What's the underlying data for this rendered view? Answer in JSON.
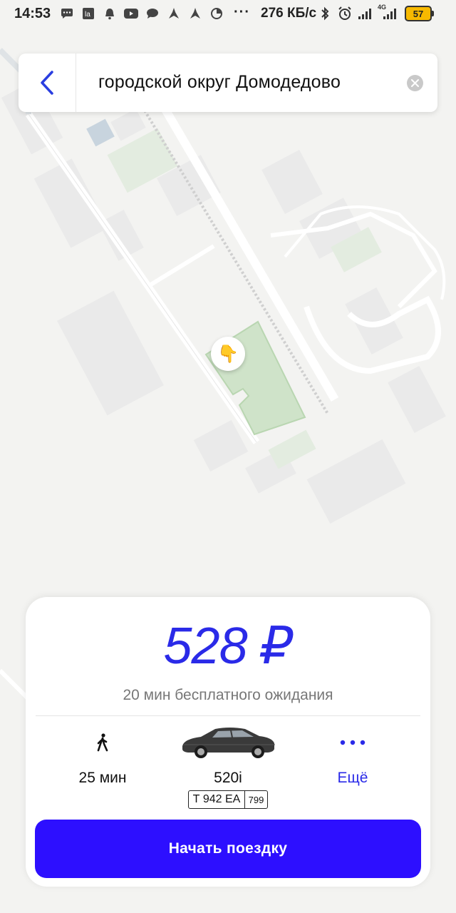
{
  "status_bar": {
    "time": "14:53",
    "speed": "276 КБ/с",
    "more_indicator": "···",
    "network_label": "4G",
    "battery": "57",
    "icons": [
      "message-icon",
      "app-icon",
      "bell-icon",
      "youtube-icon",
      "chat-icon",
      "navigation-icon",
      "navigation-icon",
      "data-saver-icon",
      "bluetooth-icon",
      "alarm-icon",
      "signal-icon",
      "signal-4g-icon",
      "battery-icon"
    ]
  },
  "search": {
    "query": "городской округ Домодедово",
    "back_icon": "chevron-left-icon",
    "clear_icon": "clear-icon"
  },
  "map": {
    "marker_emoji": "👇",
    "park_color": "#cfe3c9",
    "road_color": "#ffffff",
    "rail_color": "#bdbdbd"
  },
  "trip_card": {
    "price": "528 ₽",
    "waiting": "20 мин бесплатного ожидания",
    "walk": {
      "icon": "walking-icon",
      "label": "25 мин"
    },
    "car": {
      "icon": "car-icon",
      "label": "520i",
      "plate_main": "Т 942 ЕА",
      "plate_region": "799"
    },
    "more": {
      "icon": "more-dots-icon",
      "label": "Ещё"
    },
    "start_button": "Начать поездку",
    "accent_color": "#2d0fff"
  }
}
